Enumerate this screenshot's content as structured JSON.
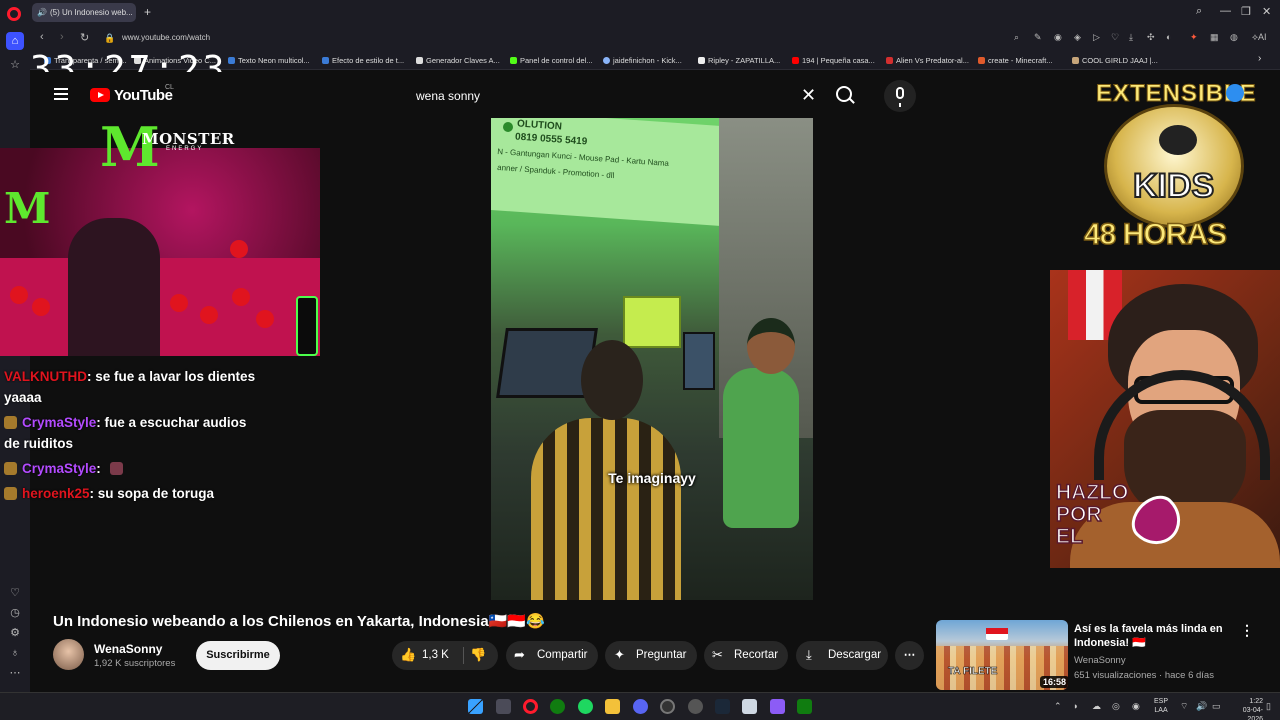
{
  "browser": {
    "tab_title": "(5) Un Indonesio web...",
    "url": "www.youtube.com/watch",
    "bookmarks": [
      "Transparenta / semi...",
      "Animations Video C...",
      "Texto Neon multicol...",
      "Efecto de estilo de t...",
      "Generador Claves A...",
      "Panel de control del...",
      "jaidefinichon - Kick...",
      "Ripley - ZAPATILLA...",
      "194 | Pequeña casa...",
      "Alien Vs Predator-al...",
      "create - Minecraft...",
      "COOL GIRLD JAAJ |..."
    ],
    "ai_label": "AI"
  },
  "overlay": {
    "timer": "33:27:23",
    "monster_brand": "MONSTER",
    "monster_sub": "ENERGY",
    "badge_top": "EXTENSIBLE",
    "badge_word": "KIDS",
    "badge_hours": "48 HORAS",
    "art_text": [
      "HAZLO",
      "POR",
      "EL"
    ]
  },
  "chat": [
    {
      "user": "VALKNUTHD",
      "user_color": "#e0141e",
      "message": ": se fue a lavar los dientes yaaaa"
    },
    {
      "user": "CrymaStyle",
      "user_color": "#b34bff",
      "message": ": fue a escuchar audios de ruiditos"
    },
    {
      "user": "CrymaStyle",
      "user_color": "#b34bff",
      "message": ":"
    },
    {
      "user": "heroenk25",
      "user_color": "#e0141e",
      "message": ": su sopa de toruga"
    }
  ],
  "youtube": {
    "logo_text": "YouTube",
    "region": "CL",
    "search_query": "wena sonny"
  },
  "video": {
    "caption": "Te imaginayy",
    "sign_phone": "0819 0555 5419",
    "sign_lines": [
      "N - Gantungan Kunci - Mouse Pad - Kartu Nama",
      "anner / Spanduk - Promotion - dll"
    ],
    "sign_top": "OLUTION",
    "title": "Un Indonesio webeando a los Chilenos en Yakarta, Indonesia🇨🇱🇮🇩😂",
    "channel": "WenaSonny",
    "subscribers": "1,92 K suscriptores",
    "subscribe_label": "Suscribirme",
    "likes": "1,3 K",
    "share_label": "Compartir",
    "ask_label": "Preguntar",
    "clip_label": "Recortar",
    "download_label": "Descargar"
  },
  "recommended": {
    "title": "Así es la favela más linda en Indonesia! 🇮🇩",
    "channel": "WenaSonny",
    "meta": "651 visualizaciones · hace 6 días",
    "duration": "16:58",
    "thumb_text": "TA FILETE"
  },
  "taskbar": {
    "lang": "ESP",
    "lang_sub": "LAA",
    "time": "1:22",
    "date": "03-04-2026"
  }
}
